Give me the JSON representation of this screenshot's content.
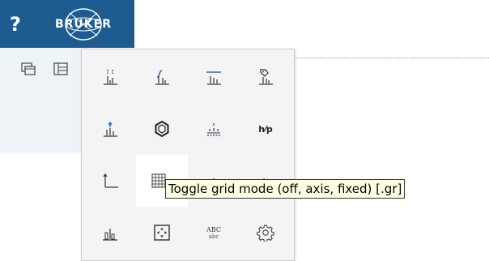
{
  "header": {
    "help_label": "?",
    "logo_text": "BRUKER",
    "accent": "#1c5c90"
  },
  "left_toolbar": {
    "icons": [
      "window-icon",
      "panel-layout-icon"
    ]
  },
  "menu": {
    "rows": [
      [
        "peak-pick-icon",
        "integrate-icon",
        "baseline-icon",
        "label-peak-icon"
      ],
      [
        "peak-up-icon",
        "molecule-icon",
        "multiplet-icon",
        "hp-icon"
      ],
      [
        "axis-icon",
        "grid-icon",
        "hidden-icon",
        "hidden-icon"
      ],
      [
        "bar-spectrum-icon",
        "fit-window-icon",
        "abc-icon",
        "settings-icon"
      ]
    ],
    "hp_label": "h⁄p",
    "abc_upper": "ABC",
    "abc_lower": "abc"
  },
  "tooltip": {
    "text": "Toggle grid mode (off, axis, fixed) [.gr]"
  }
}
